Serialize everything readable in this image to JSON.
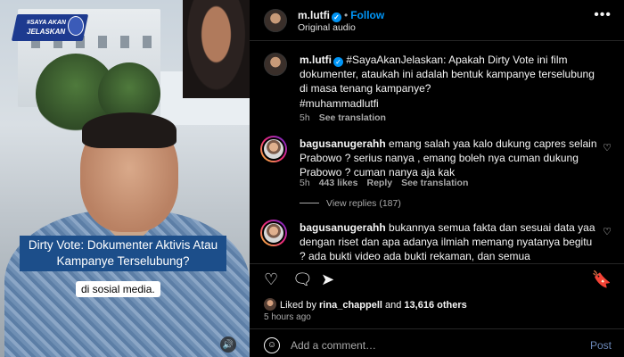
{
  "video": {
    "logo_line1": "#SAYA AKAN",
    "logo_line2": "JELASKAN",
    "caption": "Dirty Vote: Dokumenter Aktivis Atau Kampanye Terselubung?",
    "subtitle": "di sosial media."
  },
  "header": {
    "username": "m.lutfi",
    "follow_label": "Follow",
    "audio": "Original audio"
  },
  "caption": {
    "username": "m.lutfi",
    "text": "#SayaAkanJelaskan: Apakah Dirty Vote ini film dokumenter, ataukah ini adalah bentuk kampanye terselubung di masa tenang kampanye?",
    "hashtag": "#muhammadlutfi",
    "time": "5h",
    "see_translation": "See translation"
  },
  "comments": [
    {
      "username": "bagusanugerahh",
      "text": "emang salah yaa kalo dukung capres selain Prabowo ? serius nanya , emang boleh nya cuman dukung Prabowo ? cuman nanya aja kak",
      "time": "5h",
      "likes": "443 likes",
      "reply": "Reply",
      "see_translation": "See translation",
      "view_replies": "View replies (187)"
    },
    {
      "username": "bagusanugerahh",
      "text": "bukannya semua fakta dan sesuai data yaa dengan riset dan apa adanya ilmiah memang nyatanya begitu ? ada bukti video ada bukti rekaman, dan semua"
    }
  ],
  "likes": {
    "prefix": "Liked by ",
    "user": "rina_chappell",
    "middle": " and ",
    "count": "13,616 others"
  },
  "time_ago": "5 hours ago",
  "add_comment": {
    "placeholder": "Add a comment…",
    "post_label": "Post"
  },
  "icons": {
    "verified": "verified-badge-icon",
    "more": "more-options-icon",
    "like": "heart-icon",
    "comment": "comment-icon",
    "share": "share-icon",
    "save": "bookmark-icon",
    "emoji": "emoji-icon",
    "volume": "volume-icon"
  },
  "colors": {
    "accent": "#0095f6",
    "background": "#000000",
    "caption_bg": "#1c4e8a",
    "logo_bg": "#1d3a8f"
  }
}
